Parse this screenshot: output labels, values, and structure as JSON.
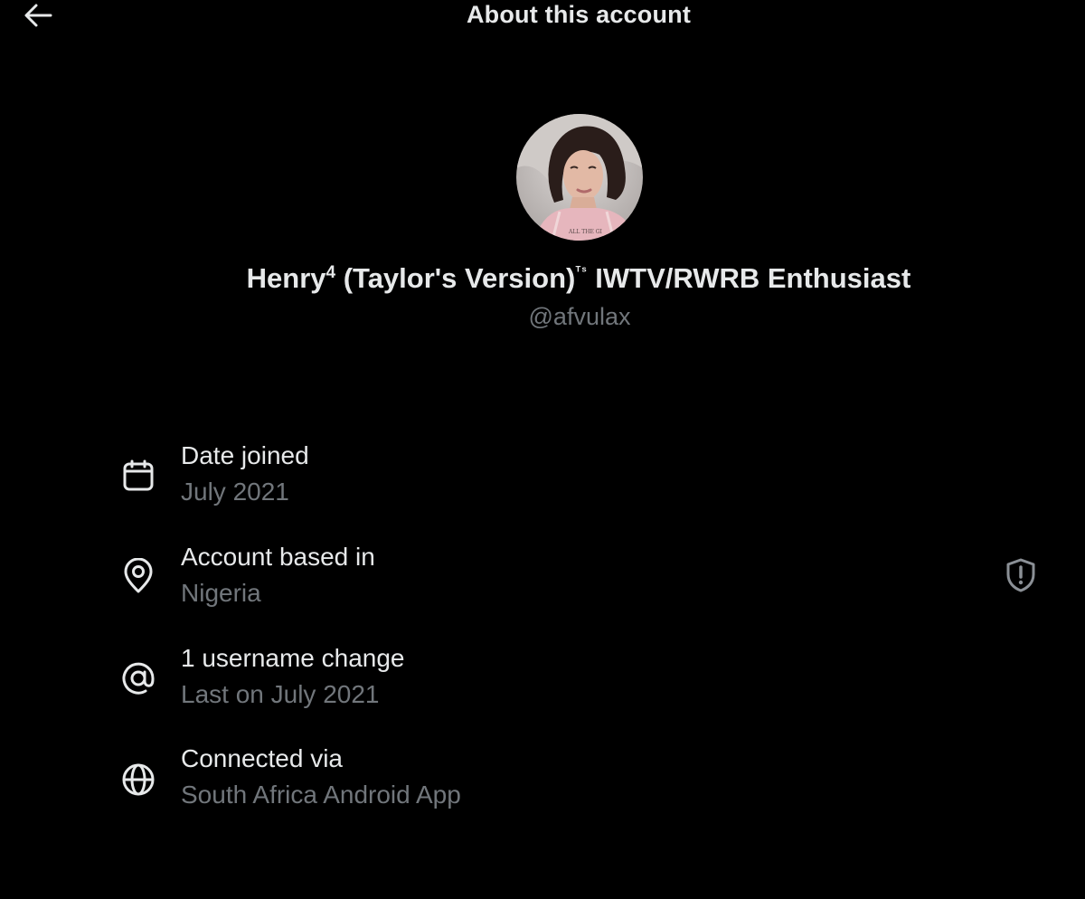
{
  "header": {
    "title": "About this account",
    "back_icon": "arrow-left-icon"
  },
  "profile": {
    "display_name_main": "Henry",
    "display_name_sup": "4",
    "display_name_version": " (Taylor's Version)",
    "display_name_ts": "ᵀˢ",
    "display_name_rest": " IWTV/RWRB Enthusiast",
    "handle": "@afvulax"
  },
  "details": {
    "date_joined": {
      "icon": "calendar-icon",
      "label": "Date joined",
      "value": "July 2021"
    },
    "account_based_in": {
      "icon": "location-pin-icon",
      "label": "Account based in",
      "value": "Nigeria",
      "action_icon": "shield-alert-icon"
    },
    "username_changes": {
      "icon": "at-sign-icon",
      "label": "1 username change",
      "value": "Last on July 2021"
    },
    "connected_via": {
      "icon": "globe-icon",
      "label": "Connected via",
      "value": "South Africa Android App"
    }
  },
  "colors": {
    "background": "#000000",
    "primary_text": "#e7e9ea",
    "secondary_text": "#71767b"
  }
}
